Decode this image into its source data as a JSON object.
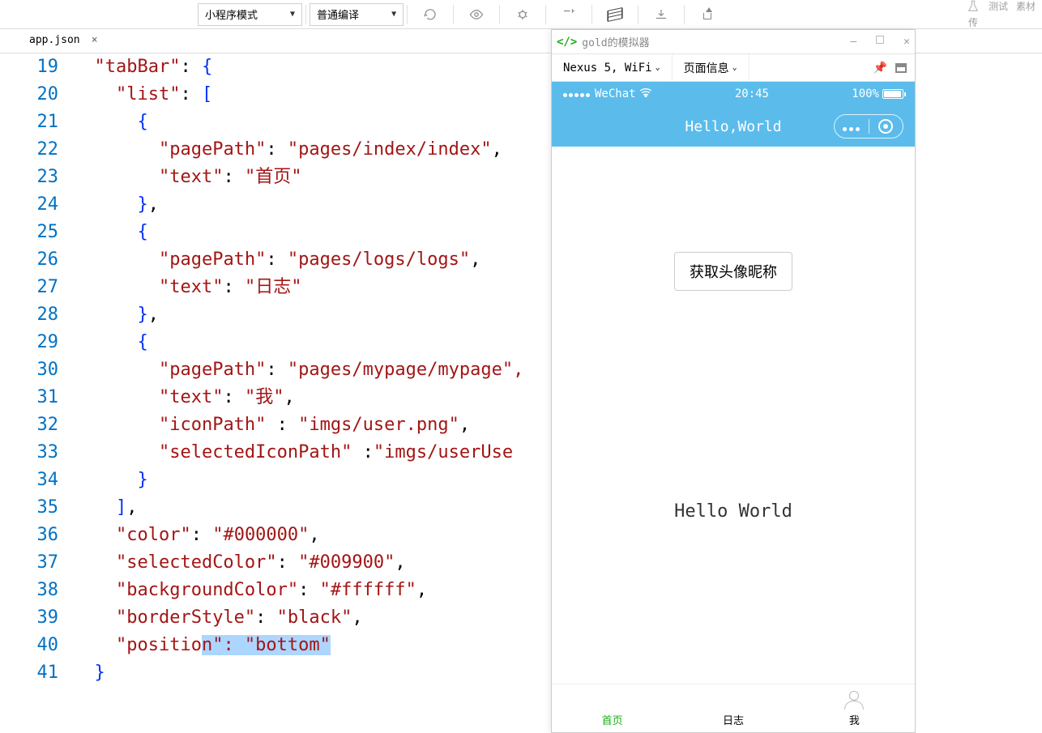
{
  "toolbar": {
    "mode_dropdown": "小程序模式",
    "compile_dropdown": "普通编译",
    "right_labels": [
      "传",
      "测试",
      "素材"
    ]
  },
  "tabs": {
    "active_file": "app.json"
  },
  "code": {
    "lines": [
      {
        "n": 19,
        "segs": [
          [
            "  ",
            ""
          ],
          [
            "\"tabBar\"",
            "key"
          ],
          [
            ":",
            "p"
          ],
          [
            " ",
            ""
          ],
          [
            "{",
            "brace"
          ]
        ]
      },
      {
        "n": 20,
        "segs": [
          [
            "    ",
            ""
          ],
          [
            "\"list\"",
            "key"
          ],
          [
            ":",
            "p"
          ],
          [
            " ",
            ""
          ],
          [
            "[",
            "brace"
          ]
        ]
      },
      {
        "n": 21,
        "segs": [
          [
            "      ",
            ""
          ],
          [
            "{",
            "brace"
          ]
        ]
      },
      {
        "n": 22,
        "segs": [
          [
            "        ",
            ""
          ],
          [
            "\"pagePath\"",
            "key"
          ],
          [
            ":",
            "p"
          ],
          [
            " ",
            ""
          ],
          [
            "\"pages/index/index\"",
            "key"
          ],
          [
            ",",
            "p"
          ]
        ]
      },
      {
        "n": 23,
        "segs": [
          [
            "        ",
            ""
          ],
          [
            "\"text\"",
            "key"
          ],
          [
            ":",
            "p"
          ],
          [
            " ",
            ""
          ],
          [
            "\"首页\"",
            "key"
          ]
        ]
      },
      {
        "n": 24,
        "segs": [
          [
            "      ",
            ""
          ],
          [
            "}",
            "brace"
          ],
          [
            ",",
            "p"
          ]
        ]
      },
      {
        "n": 25,
        "segs": [
          [
            "      ",
            ""
          ],
          [
            "{",
            "brace"
          ]
        ]
      },
      {
        "n": 26,
        "segs": [
          [
            "        ",
            ""
          ],
          [
            "\"pagePath\"",
            "key"
          ],
          [
            ":",
            "p"
          ],
          [
            " ",
            ""
          ],
          [
            "\"pages/logs/logs\"",
            "key"
          ],
          [
            ",",
            "p"
          ]
        ]
      },
      {
        "n": 27,
        "segs": [
          [
            "        ",
            ""
          ],
          [
            "\"text\"",
            "key"
          ],
          [
            ":",
            "p"
          ],
          [
            " ",
            ""
          ],
          [
            "\"日志\"",
            "key"
          ]
        ]
      },
      {
        "n": 28,
        "segs": [
          [
            "      ",
            ""
          ],
          [
            "}",
            "brace"
          ],
          [
            ",",
            "p"
          ]
        ]
      },
      {
        "n": 29,
        "segs": [
          [
            "      ",
            ""
          ],
          [
            "{",
            "brace"
          ]
        ]
      },
      {
        "n": 30,
        "segs": [
          [
            "        ",
            ""
          ],
          [
            "\"pagePath\"",
            "key"
          ],
          [
            ":",
            "p"
          ],
          [
            " ",
            ""
          ],
          [
            "\"pages/mypage/mypage\"",
            "key"
          ],
          [
            ",",
            "cut"
          ]
        ]
      },
      {
        "n": 31,
        "segs": [
          [
            "        ",
            ""
          ],
          [
            "\"text\"",
            "key"
          ],
          [
            ":",
            "p"
          ],
          [
            " ",
            ""
          ],
          [
            "\"我\"",
            "key"
          ],
          [
            ",",
            "p"
          ]
        ]
      },
      {
        "n": 32,
        "segs": [
          [
            "        ",
            ""
          ],
          [
            "\"iconPath\"",
            "key"
          ],
          [
            " :",
            "p"
          ],
          [
            " ",
            ""
          ],
          [
            "\"imgs/user.png\"",
            "key"
          ],
          [
            ",",
            "p"
          ]
        ]
      },
      {
        "n": 33,
        "segs": [
          [
            "        ",
            ""
          ],
          [
            "\"selectedIconPath\"",
            "key"
          ],
          [
            " :",
            "p"
          ],
          [
            "\"imgs/userUse",
            "cut"
          ]
        ]
      },
      {
        "n": 34,
        "segs": [
          [
            "      ",
            ""
          ],
          [
            "}",
            "brace"
          ]
        ]
      },
      {
        "n": 35,
        "segs": [
          [
            "    ",
            ""
          ],
          [
            "]",
            "brace"
          ],
          [
            ",",
            "p"
          ]
        ]
      },
      {
        "n": 36,
        "segs": [
          [
            "    ",
            ""
          ],
          [
            "\"color\"",
            "key"
          ],
          [
            ":",
            "p"
          ],
          [
            " ",
            ""
          ],
          [
            "\"#000000\"",
            "key"
          ],
          [
            ",",
            "p"
          ]
        ]
      },
      {
        "n": 37,
        "segs": [
          [
            "    ",
            ""
          ],
          [
            "\"selectedColor\"",
            "key"
          ],
          [
            ":",
            "p"
          ],
          [
            " ",
            ""
          ],
          [
            "\"#009900\"",
            "key"
          ],
          [
            ",",
            "p"
          ]
        ]
      },
      {
        "n": 38,
        "segs": [
          [
            "    ",
            ""
          ],
          [
            "\"backgroundColor\"",
            "key"
          ],
          [
            ":",
            "p"
          ],
          [
            " ",
            ""
          ],
          [
            "\"#ffffff\"",
            "key"
          ],
          [
            ",",
            "p"
          ]
        ]
      },
      {
        "n": 39,
        "segs": [
          [
            "    ",
            ""
          ],
          [
            "\"borderStyle\"",
            "key"
          ],
          [
            ":",
            "p"
          ],
          [
            " ",
            ""
          ],
          [
            "\"black\"",
            "key"
          ],
          [
            ",",
            "p"
          ]
        ]
      },
      {
        "n": 40,
        "segs": [
          [
            "    ",
            ""
          ],
          [
            "\"positio",
            "key"
          ],
          [
            "n\": \"bottom\"",
            "sel"
          ]
        ]
      },
      {
        "n": 41,
        "segs": [
          [
            "  ",
            ""
          ],
          [
            "}",
            "brace"
          ]
        ]
      }
    ]
  },
  "sim": {
    "window_title": "gold的模拟器",
    "device": "Nexus 5, WiFi",
    "page_info": "页面信息",
    "status": {
      "carrier": "WeChat",
      "time": "20:45",
      "battery": "100%"
    },
    "nav_title": "Hello,World",
    "button": "获取头像昵称",
    "body_text": "Hello World",
    "tabs": [
      {
        "label": "首页",
        "active": true,
        "icon": "none"
      },
      {
        "label": "日志",
        "active": false,
        "icon": "none"
      },
      {
        "label": "我",
        "active": false,
        "icon": "user"
      }
    ]
  }
}
